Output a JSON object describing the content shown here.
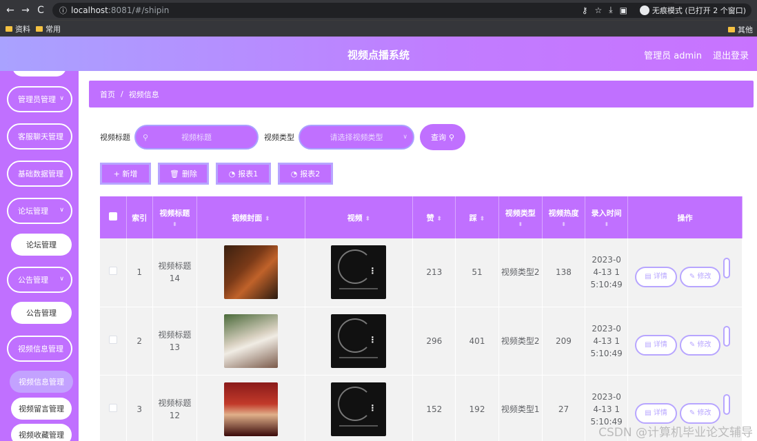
{
  "browser": {
    "nav_back": "←",
    "nav_forward": "→",
    "reload": "C",
    "info_icon": "ⓘ",
    "url_host": "localhost",
    "url_path": ":8081/#/shipin",
    "incognito_label": "无痕模式 (已打开 2 个窗口)",
    "bookmarks": [
      {
        "label": "资料"
      },
      {
        "label": "常用"
      }
    ],
    "bookmarks_right": "其他"
  },
  "header": {
    "title": "视频点播系统",
    "user": "管理员 admin",
    "logout": "退出登录"
  },
  "sidebar": {
    "menus": [
      {
        "label": "管理员管理"
      },
      {
        "label": "客服聊天管理"
      },
      {
        "label": "基础数据管理"
      },
      {
        "label": "论坛管理"
      },
      {
        "label": "公告管理"
      },
      {
        "label": "视频信息管理"
      }
    ],
    "subs": [
      {
        "label": "论坛管理"
      },
      {
        "label": "公告管理"
      },
      {
        "label": "视频信息管理"
      },
      {
        "label": "视频留言管理"
      },
      {
        "label": "视频收藏管理"
      }
    ]
  },
  "breadcrumb": {
    "home": "首页",
    "sep": "/",
    "current": "视频信息"
  },
  "search": {
    "title_label": "视频标题",
    "title_placeholder": "视频标题",
    "type_label": "视频类型",
    "type_placeholder": "请选择视频类型",
    "query_label": "查询"
  },
  "actions": {
    "add": "+ 新增",
    "delete": "删除",
    "report1": "报表1",
    "report2": "报表2"
  },
  "table": {
    "headers": {
      "index": "索引",
      "title": "视频标题",
      "cover": "视频封面",
      "video": "视频",
      "like": "赞",
      "dislike": "踩",
      "type": "视频类型",
      "heat": "视频热度",
      "time": "录入时间",
      "ops": "操作"
    },
    "sort_glyph": "⬍",
    "rows": [
      {
        "index": "1",
        "title": "视频标题14",
        "like": "213",
        "dislike": "51",
        "type": "视频类型2",
        "heat": "138",
        "time": "2023-04-13 15:10:49"
      },
      {
        "index": "2",
        "title": "视频标题13",
        "like": "296",
        "dislike": "401",
        "type": "视频类型2",
        "heat": "209",
        "time": "2023-04-13 15:10:49"
      },
      {
        "index": "3",
        "title": "视频标题12",
        "like": "152",
        "dislike": "192",
        "type": "视频类型1",
        "heat": "27",
        "time": "2023-04-13 15:10:49"
      }
    ],
    "op_detail": "详情",
    "op_edit": "修改"
  },
  "watermark": "CSDN @计算机毕业论文辅导"
}
